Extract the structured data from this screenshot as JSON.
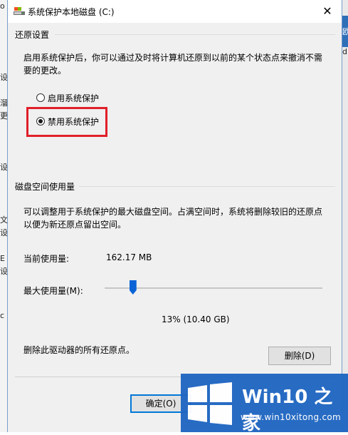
{
  "dialog": {
    "title": "系统保护本地磁盘 (C:)",
    "close_glyph": "✕"
  },
  "restore": {
    "heading": "还原设置",
    "description_line1": "启用系统保护后，你可以通过及时将计算机还原到以前的某个状态点来撤消不需",
    "description_line2": "要的更改。",
    "enable_label": "启用系统保护",
    "disable_label": "禁用系统保护",
    "selected": "disable"
  },
  "disk": {
    "heading": "磁盘空间使用量",
    "description_line1": "可以调整用于系统保护的最大磁盘空间。占满空间时，系统将删除较旧的还原点",
    "description_line2": "以便为新还原点留出空间。",
    "current_label": "当前使用量:",
    "current_value": "162.17 MB",
    "max_label": "最大使用量(M):",
    "max_fraction": 0.13,
    "max_value": "13% (10.40 GB)",
    "delete_text": "删除此驱动器的所有还原点。",
    "delete_button": "删除(D)"
  },
  "footer": {
    "ok_button": "确定(O)"
  },
  "background": {
    "left_fragments": [
      "o",
      "设",
      "溜",
      "更",
      "设",
      "文",
      "设",
      "E",
      "设",
      "c"
    ],
    "right_fragments": [
      "欧",
      "d"
    ]
  },
  "watermark": {
    "brand": "Win10 之家",
    "url": "www.win10xitong.com"
  },
  "colors": {
    "accent": "#0078d7",
    "highlight_border": "#e0202a",
    "watermark_bg": "#1f66c2"
  }
}
